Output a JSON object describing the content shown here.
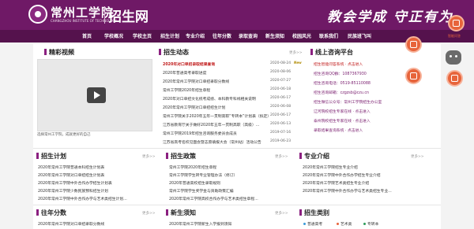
{
  "header": {
    "school_name": "常州工学院",
    "school_name_en": "CHANGZHOU INSTITUTE OF TECHNOLOGY",
    "site_title": "招生网",
    "motto": "教会学成 守正有为"
  },
  "nav": {
    "items": [
      "首页",
      "学校概况",
      "学校主页",
      "招生计划",
      "专业介绍",
      "往年分数",
      "录取查询",
      "新生须知",
      "校园风光",
      "联系我们",
      "民族班飞叫"
    ]
  },
  "video": {
    "title": "精彩视频",
    "caption": "选择常州工学院，成就更好的自己"
  },
  "news": {
    "title": "招生动态",
    "more": "更多>>",
    "tag": "New",
    "items": [
      {
        "text": "2020年对口单招录取结果查询",
        "date": "2020-08-24",
        "highlight": true
      },
      {
        "text": "2020年普通高考录取进度",
        "date": "2020-08-06",
        "highlight": false
      },
      {
        "text": "2020年常州工学院对口单招录取分数线",
        "date": "2020-07-27",
        "highlight": false
      },
      {
        "text": "常州工学院2020年招生章程",
        "date": "2020-06-18",
        "highlight": false
      },
      {
        "text": "2020年对口单招文化统考成绩、本科教专科线相关说明",
        "date": "2020-06-17",
        "highlight": false
      },
      {
        "text": "2020年常州工学院对口单招招生计划",
        "date": "2020-06-08",
        "highlight": false
      },
      {
        "text": "常州工学院关于2020年五年一贯制高职“专转本”计划表（拟定）",
        "date": "2020-06-17",
        "highlight": false
      },
      {
        "text": "江苏省教育厅关于做好2020年五年一贯制高职（高级）...",
        "date": "2020-06-13",
        "highlight": false
      },
      {
        "text": "常州工学院2019年招生咨询服务委员会成员",
        "date": "2019-07-16",
        "highlight": false
      },
      {
        "text": "江苏省高考名校见面会暨志愿填报大会（常州站）活动公告",
        "date": "2019-06-23",
        "highlight": false
      }
    ]
  },
  "contact": {
    "title": "线上咨询平台",
    "lines": [
      "招生智能问答系统 · 点击进入",
      "招生咨询QQ群：1087367930",
      "招生咨询电话：0519-85110088",
      "招生咨询邮箱：czgzsb@czu.cn",
      "招生微信公众号：常州工学院招生办公室",
      "辽河院校招生专家在线 · 点击进入",
      "泰州院校招生专家在线 · 点击进入",
      "录取结果查询系统 · 点击进入"
    ]
  },
  "plan": {
    "title": "招生计划",
    "more": "更多>>",
    "items": [
      "2020年常州工学院普通本科招生计划表",
      "2020年常州工学院对口单招招生计划表",
      "2020年常州工学院中外合作办学招生计划表",
      "2020年常州工学院少数民族预科招生计划",
      "2020年常州工学院中外合作办学与艺术类招生计划..."
    ]
  },
  "policy": {
    "title": "招生政策",
    "more": "更多>>",
    "items": [
      "常州工学院2020年招生章程",
      "常州工学院学生转专业管理办法（修订）",
      "2020年普通高校招生录取规则",
      "常州工学院学生奖学金与资助政策汇编",
      "2020年常州工学院高校合作办学与艺术类招生章程..."
    ]
  },
  "major": {
    "title": "专业介绍",
    "more": "更多>>",
    "items": [
      "2020年常州工学院招生专业介绍",
      "2020年常州工学院中外合作办学招生专业介绍",
      "2020年常州工学院艺术类招生专业介绍",
      "2020年常州工学院中外合作办学与艺术类招生专业..."
    ]
  },
  "scores": {
    "title": "往年分数",
    "more": "更多>>",
    "items": [
      "2020年常州工学院对口单招录取分数线"
    ]
  },
  "notice": {
    "title": "新生须知",
    "more": "更多>>",
    "items": [
      "2020年常州工学院新生入学报到须知"
    ]
  },
  "categories": {
    "title": "招生类别",
    "items": [
      "普通高考",
      "艺术类",
      "专转本"
    ]
  },
  "floating": {
    "items": [
      "智能问答",
      "咨询电话",
      "联系QQ"
    ]
  },
  "colors": {
    "brand": "#6f1966",
    "accent": "#e7643b",
    "highlight": "#c01818"
  }
}
